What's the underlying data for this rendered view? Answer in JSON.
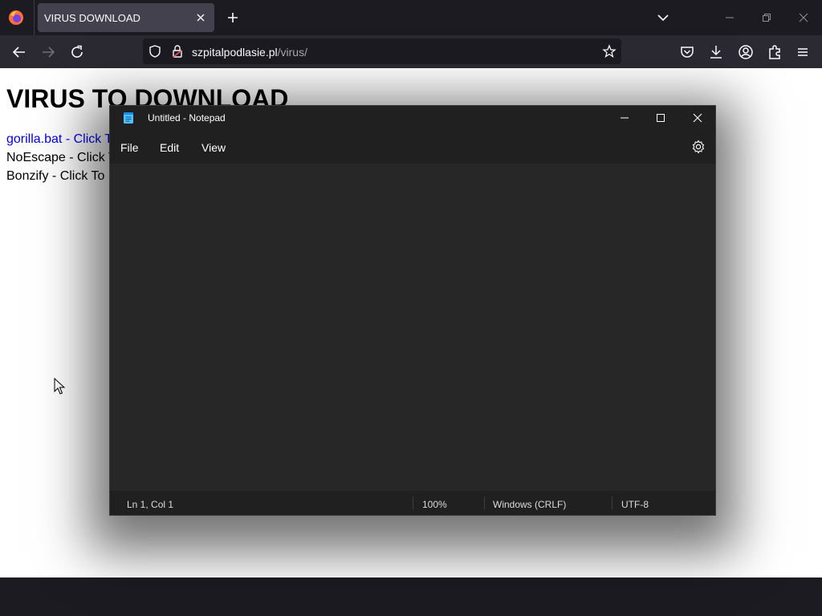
{
  "browser": {
    "tab_title": "VIRUS DOWNLOAD",
    "url_domain": "szpitalpodlasie.pl",
    "url_path": "/virus/"
  },
  "page": {
    "heading": "VIRUS TO DOWNLOAD",
    "lines": [
      {
        "text": "gorilla.bat - Click To Download",
        "is_link": true
      },
      {
        "text": "NoEscape - Click To Download",
        "is_link": false
      },
      {
        "text": "Bonzify - Click To Download",
        "is_link": false
      }
    ]
  },
  "notepad": {
    "title": "Untitled - Notepad",
    "menu": {
      "file": "File",
      "edit": "Edit",
      "view": "View"
    },
    "status": {
      "position": "Ln 1, Col 1",
      "zoom": "100%",
      "line_endings": "Windows (CRLF)",
      "encoding": "UTF-8"
    }
  },
  "colors": {
    "link": "#0000ee",
    "firefox_toolbar": "#2b2a33",
    "notepad_bg": "#272727"
  },
  "icons": [
    "firefox-logo-icon",
    "close-icon",
    "plus-icon",
    "chevron-down-icon",
    "minimize-icon",
    "restore-icon",
    "back-arrow-icon",
    "forward-arrow-icon",
    "reload-icon",
    "shield-icon",
    "permissions-icon",
    "star-icon",
    "pocket-icon",
    "download-icon",
    "account-icon",
    "extensions-icon",
    "hamburger-menu-icon",
    "notepad-icon",
    "maximize-icon",
    "gear-icon",
    "mouse-cursor-icon"
  ]
}
